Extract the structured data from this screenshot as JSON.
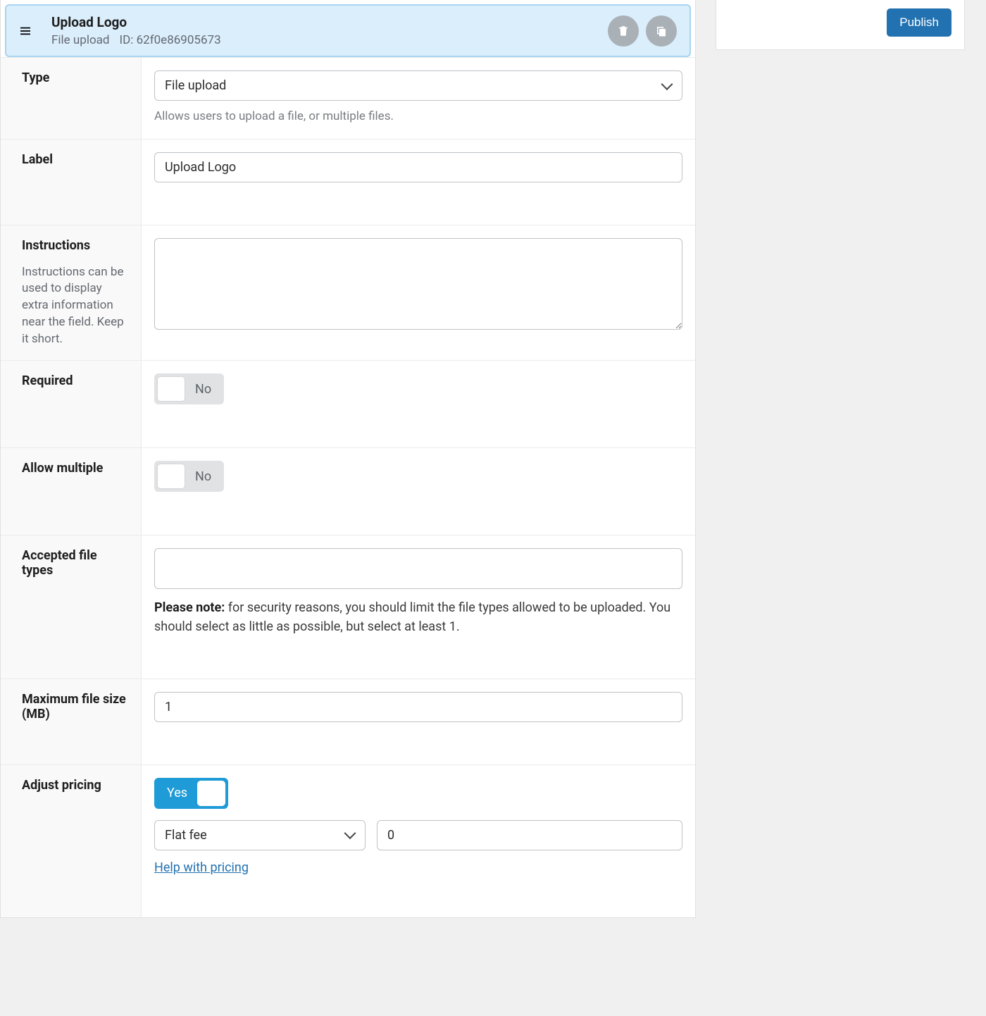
{
  "header": {
    "title": "Upload Logo",
    "type_label": "File upload",
    "id_label": "ID:",
    "id_value": "62f0e86905673"
  },
  "sidebar": {
    "publish_label": "Publish"
  },
  "rows": {
    "type": {
      "label": "Type",
      "value": "File upload",
      "hint": "Allows users to upload a file, or multiple files."
    },
    "label": {
      "label": "Label",
      "value": "Upload Logo"
    },
    "instructions": {
      "label": "Instructions",
      "help": "Instructions can be used to display extra information near the field. Keep it short.",
      "value": ""
    },
    "required": {
      "label": "Required",
      "value_label": "No"
    },
    "allow_multiple": {
      "label": "Allow multiple",
      "value_label": "No"
    },
    "accepted_types": {
      "label": "Accepted file types",
      "note_strong": "Please note:",
      "note_rest": " for security reasons, you should limit the file types allowed to be uploaded. You should select as little as possible, but select at least 1."
    },
    "max_size": {
      "label": "Maximum file size (MB)",
      "value": "1"
    },
    "adjust_pricing": {
      "label": "Adjust pricing",
      "value_label": "Yes",
      "fee_type": "Flat fee",
      "fee_amount": "0",
      "help_link": "Help with pricing"
    }
  }
}
